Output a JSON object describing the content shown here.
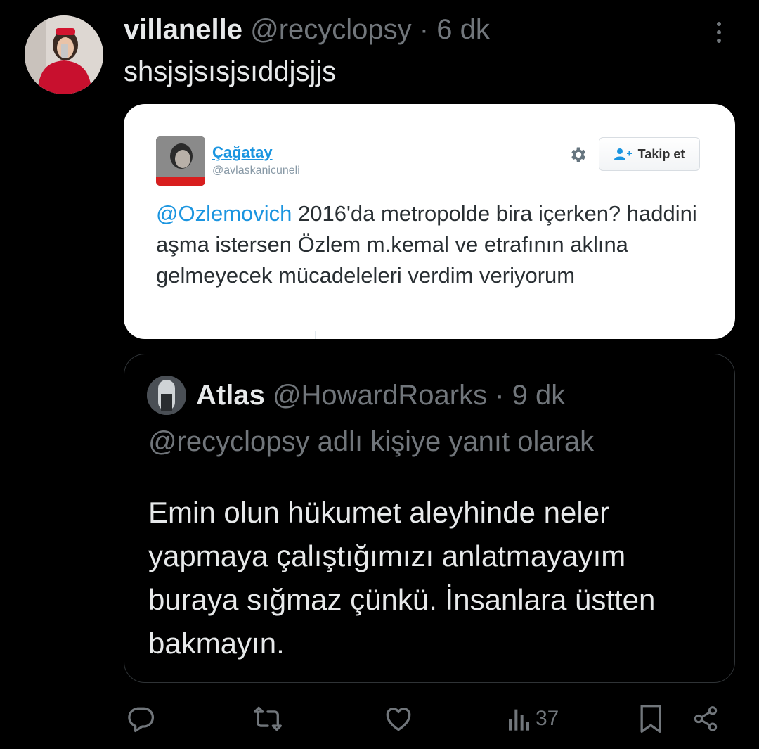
{
  "tweet": {
    "author_name": "villanelle",
    "author_handle": "@recyclopsy",
    "separator": "·",
    "time": "6 dk",
    "text": "shsjsjsısjsıddjsjjs"
  },
  "media": {
    "author_name": "Çağatay",
    "author_handle": "@avlaskanicuneli",
    "follow_label": "Takip et",
    "mention": "@Ozlemovich",
    "text": " 2016'da metropolde bira içerken? haddini aşma istersen Özlem m.kemal ve etrafının aklına gelmeyecek mücadeleleri verdim veriyorum"
  },
  "quote": {
    "author_name": "Atlas",
    "author_handle": "@HowardRoarks",
    "separator": "·",
    "time": "9 dk",
    "reply_context": "@recyclopsy adlı kişiye yanıt olarak",
    "text": "Emin olun hükumet aleyhinde neler yapmaya çalıştığımızı anlatmayayım buraya sığmaz çünkü. İnsanlara üstten bakmayın."
  },
  "actions": {
    "views_count": "37"
  },
  "icons": [
    "more-icon",
    "gear-icon",
    "follow-icon",
    "reply-icon",
    "retweet-icon",
    "like-icon",
    "views-icon",
    "bookmark-icon",
    "share-icon"
  ],
  "colors": {
    "background": "#000000",
    "primary_text": "#e7e9ea",
    "secondary_text": "#71767b",
    "border": "#2f3336",
    "link_blue": "#1b95e0"
  }
}
